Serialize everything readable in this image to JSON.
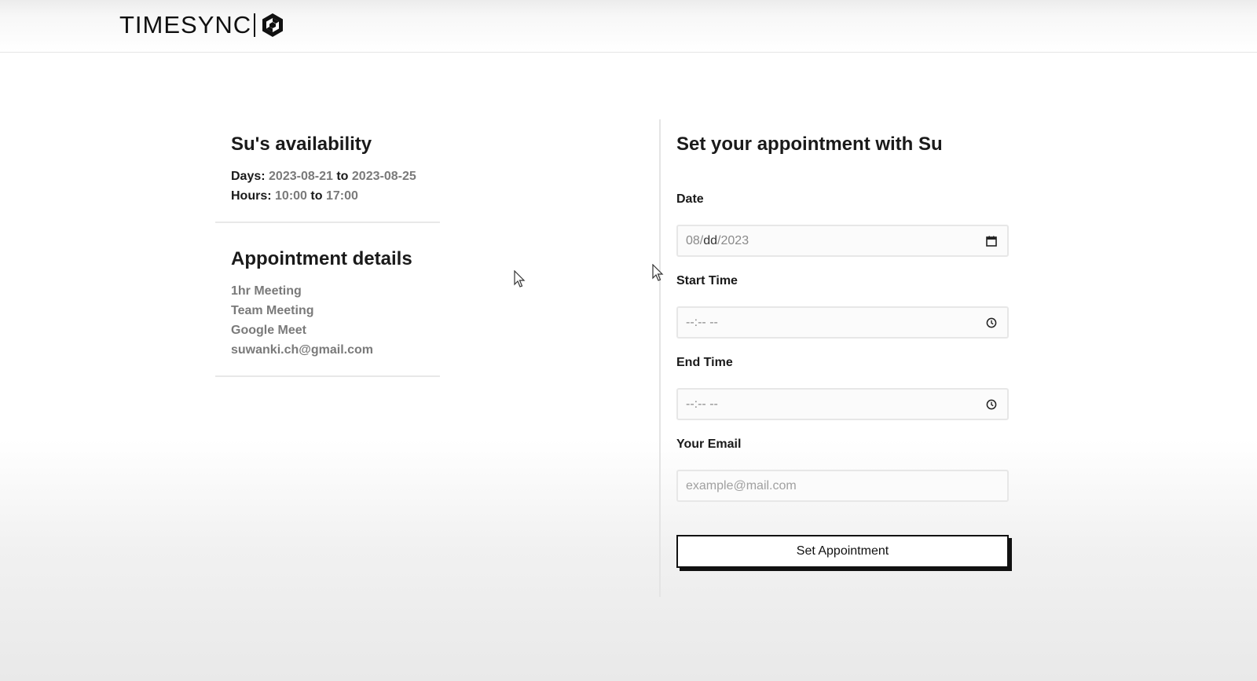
{
  "header": {
    "brand": "TIMESYNC"
  },
  "availability": {
    "title": "Su's availability",
    "days_label": "Days:",
    "days_from": "2023-08-21",
    "days_to": "2023-08-25",
    "hours_label": "Hours:",
    "hours_from": "10:00",
    "hours_to": "17:00",
    "connector": "to"
  },
  "details": {
    "title": "Appointment details",
    "items": [
      "1hr Meeting",
      "Team Meeting",
      "Google Meet",
      "suwanki.ch@gmail.com"
    ]
  },
  "form": {
    "title": "Set your appointment with Su",
    "date_label": "Date",
    "date_value_mm": "08",
    "date_value_sep1": "/",
    "date_value_dd": "dd",
    "date_value_sep2": "/",
    "date_value_yyyy": "2023",
    "start_label": "Start Time",
    "start_value": "--:-- --",
    "end_label": "End Time",
    "end_value": "--:-- --",
    "email_label": "Your Email",
    "email_placeholder": "example@mail.com",
    "submit_label": "Set Appointment"
  },
  "icons": {
    "calendar": "calendar-icon",
    "clock": "clock-icon",
    "logo": "timesync-logo-icon"
  }
}
